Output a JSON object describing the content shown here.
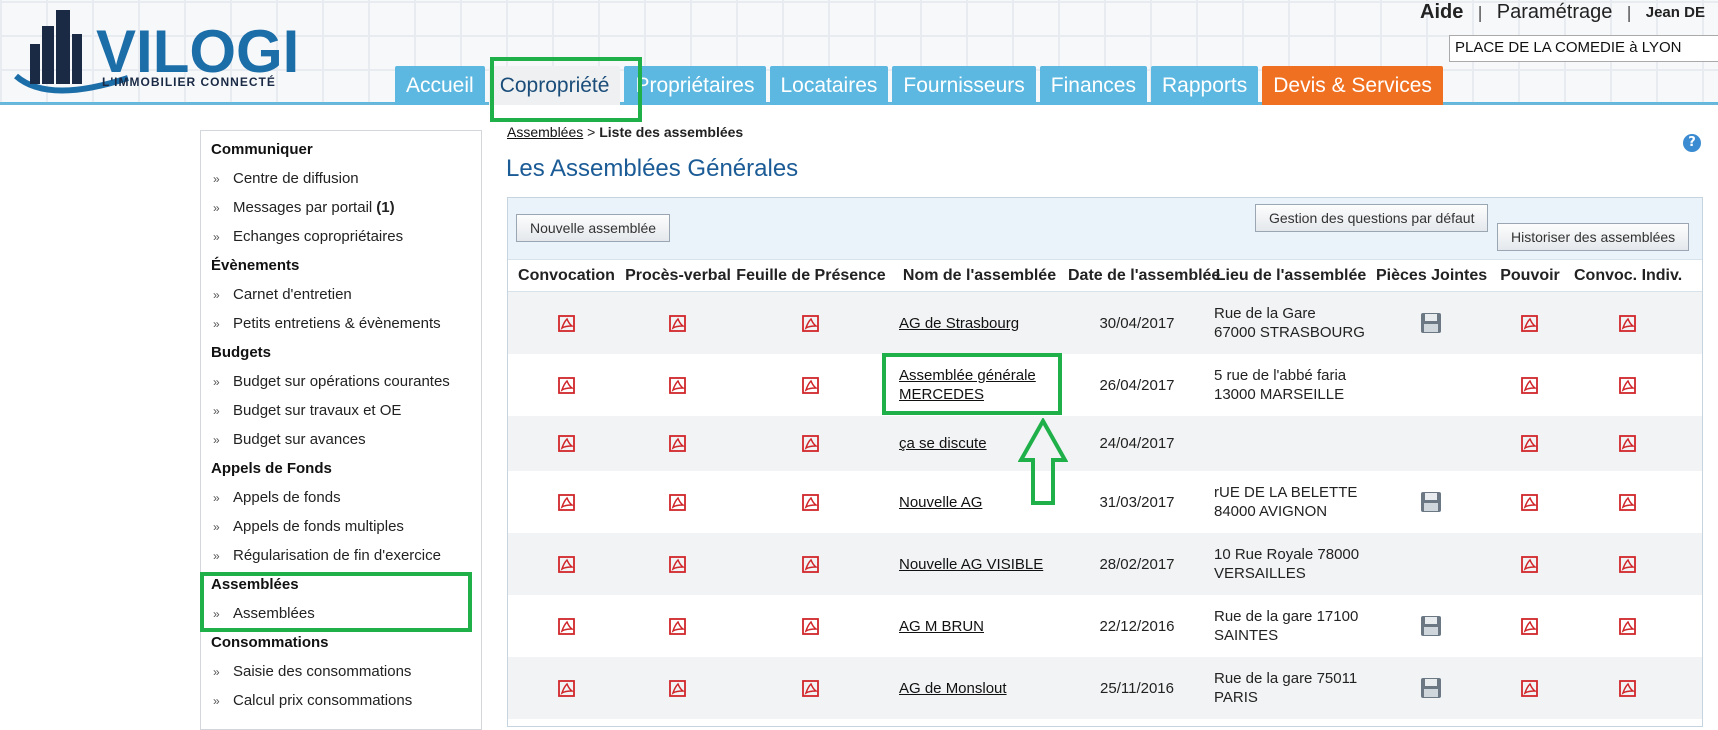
{
  "logo": {
    "brand": "VILOGI",
    "tagline": "L'IMMOBILIER CONNECTÉ"
  },
  "toplinks": {
    "aide": "Aide",
    "sep": "|",
    "parametrage": "Paramétrage",
    "user": "Jean DE"
  },
  "building_select": {
    "value": "PLACE DE LA COMEDIE à LYON"
  },
  "tabs": [
    "Accueil",
    "Copropriété",
    "Propriétaires",
    "Locataires",
    "Fournisseurs",
    "Finances",
    "Rapports",
    "Devis & Services"
  ],
  "active_tab": "Copropriété",
  "colors": {
    "tab": "#5cb8e0",
    "devis": "#f07022",
    "highlight": "#20b04a",
    "title": "#1b5b96",
    "pdf": "#d0262a"
  },
  "sidebar": {
    "sections": [
      {
        "title": "Communiquer",
        "items": [
          {
            "label": "Centre de diffusion"
          },
          {
            "label": "Messages par portail",
            "badge": "(1)"
          },
          {
            "label": "Echanges copropriétaires"
          }
        ]
      },
      {
        "title": "Évènements",
        "items": [
          {
            "label": "Carnet d'entretien"
          },
          {
            "label": "Petits entretiens & évènements"
          }
        ]
      },
      {
        "title": "Budgets",
        "items": [
          {
            "label": "Budget sur opérations courantes"
          },
          {
            "label": "Budget sur travaux et OE"
          },
          {
            "label": "Budget sur avances"
          }
        ]
      },
      {
        "title": "Appels de Fonds",
        "items": [
          {
            "label": "Appels de fonds"
          },
          {
            "label": "Appels de fonds multiples"
          },
          {
            "label": "Régularisation de fin d'exercice"
          }
        ]
      },
      {
        "title": "Assemblées",
        "items": [
          {
            "label": "Assemblées"
          }
        ]
      },
      {
        "title": "Consommations",
        "items": [
          {
            "label": "Saisie des consommations"
          },
          {
            "label": "Calcul prix consommations"
          }
        ]
      }
    ]
  },
  "breadcrumb": {
    "parent": "Assemblées",
    "sep": ">",
    "current": "Liste des assemblées"
  },
  "page_title": "Les Assemblées Générales",
  "toolbar": {
    "new": "Nouvelle assemblée",
    "questions": "Gestion des questions par défaut",
    "history": "Historiser des assemblées"
  },
  "table": {
    "columns": [
      "Convocation",
      "Procès-verbal",
      "Feuille de Présence",
      "Nom de l'assemblée",
      "Date de l'assemblée",
      "Lieu de l'assemblée",
      "Pièces Jointes",
      "Pouvoir",
      "Convoc. Indiv."
    ],
    "rows": [
      {
        "name": "AG de Strasbourg",
        "date": "30/04/2017",
        "lieu1": "Rue de la Gare",
        "lieu2": "67000 STRASBOURG",
        "pj": true
      },
      {
        "name": "Assemblée générale",
        "name2": "MERCEDES",
        "date": "26/04/2017",
        "lieu1": "5 rue de l'abbé faria",
        "lieu2": "13000 MARSEILLE",
        "pj": false
      },
      {
        "name": "ça se discute",
        "date": "24/04/2017",
        "lieu1": "",
        "lieu2": "",
        "pj": false
      },
      {
        "name": "Nouvelle AG",
        "date": "31/03/2017",
        "lieu1": "rUE DE LA BELETTE",
        "lieu2": "84000 AVIGNON",
        "pj": true
      },
      {
        "name": "Nouvelle AG VISIBLE",
        "date": "28/02/2017",
        "lieu1": "10 Rue Royale 78000",
        "lieu2": "VERSAILLES",
        "pj": false
      },
      {
        "name": "AG M BRUN",
        "date": "22/12/2016",
        "lieu1": "Rue de la gare 17100",
        "lieu2": "SAINTES",
        "pj": true
      },
      {
        "name": "AG de Monslout",
        "date": "25/11/2016",
        "lieu1": "Rue de la gare 75011",
        "lieu2": "PARIS",
        "pj": true
      }
    ]
  }
}
